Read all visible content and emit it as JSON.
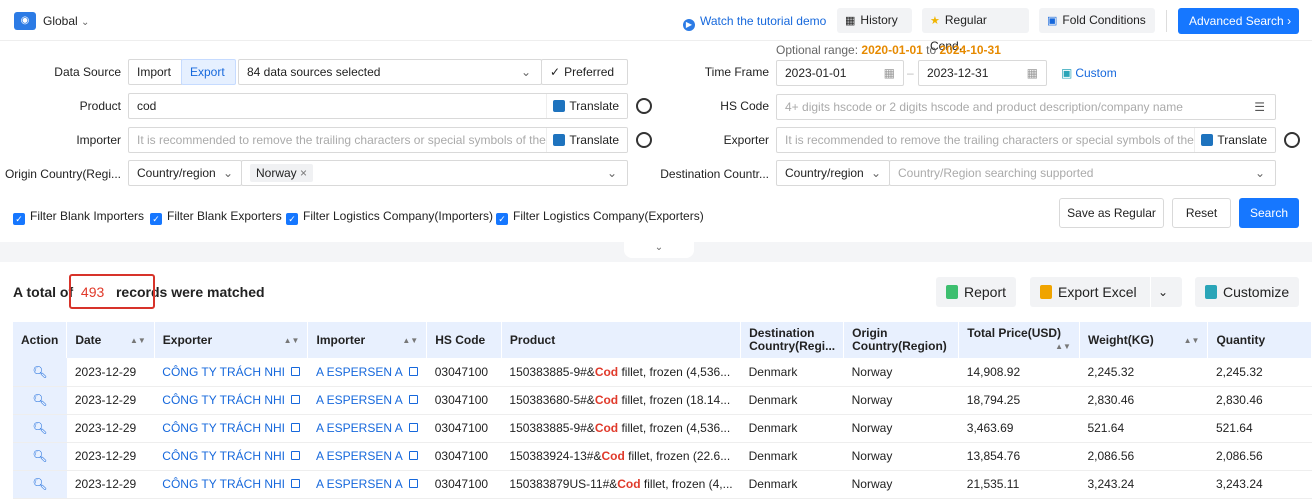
{
  "topbar": {
    "region": "Global",
    "tutorial": "Watch the tutorial demo",
    "history": "History",
    "regular": "Regular Cond.",
    "fold": "Fold Conditions",
    "advanced": "Advanced Search"
  },
  "range": {
    "label": "Optional range:",
    "from": "2020-01-01",
    "to_word": "to",
    "to": "2024-10-31"
  },
  "form": {
    "data_source_label": "Data Source",
    "import": "Import",
    "export": "Export",
    "sources": "84 data sources selected",
    "preferred": "Preferred",
    "time_frame_label": "Time Frame",
    "date_from": "2023-01-01",
    "date_to": "2023-12-31",
    "custom": "Custom",
    "product_label": "Product",
    "product_value": "cod",
    "translate": "Translate",
    "hs_label": "HS Code",
    "hs_placeholder": "4+ digits hscode or 2 digits hscode and product description/company name",
    "importer_label": "Importer",
    "importer_placeholder": "It is recommended to remove the trailing characters or special symbols of the company name",
    "exporter_label": "Exporter",
    "exporter_placeholder": "It is recommended to remove the trailing characters or special symbols of the company name",
    "origin_label": "Origin Country(Regi...",
    "country_region": "Country/region",
    "origin_tag": "Norway",
    "dest_label": "Destination Countr...",
    "dest_placeholder": "Country/Region searching supported"
  },
  "filters": [
    "Filter Blank Importers",
    "Filter Blank Exporters",
    "Filter Logistics Company(Importers)",
    "Filter Logistics Company(Exporters)"
  ],
  "actions": {
    "save": "Save as Regular",
    "reset": "Reset",
    "search": "Search"
  },
  "results": {
    "prefix": "A total of",
    "count": "493",
    "records": "records",
    "suffix": "were matched"
  },
  "tools": {
    "report": "Report",
    "excel": "Export Excel",
    "customize": "Customize"
  },
  "table": {
    "headers": [
      "Action",
      "Date",
      "Exporter",
      "Importer",
      "HS Code",
      "Product",
      "Destination Country(Regi...",
      "Origin Country(Region)",
      "Total Price(USD)",
      "Weight(KG)",
      "Quantity"
    ],
    "rows": [
      {
        "date": "2023-12-29",
        "exporter": "CÔNG TY TRÁCH NHI",
        "importer": "A ESPERSEN A",
        "hs": "03047100",
        "pre": "150383885-9#&",
        "kw": "Cod",
        "post": " fillet, frozen (4,536...",
        "dest": "Denmark",
        "origin": "Norway",
        "price": "14,908.92",
        "weight": "2,245.32",
        "qty": "2,245.32"
      },
      {
        "date": "2023-12-29",
        "exporter": "CÔNG TY TRÁCH NHI",
        "importer": "A ESPERSEN A",
        "hs": "03047100",
        "pre": "150383680-5#&",
        "kw": "Cod",
        "post": " fillet, frozen (18.14...",
        "dest": "Denmark",
        "origin": "Norway",
        "price": "18,794.25",
        "weight": "2,830.46",
        "qty": "2,830.46"
      },
      {
        "date": "2023-12-29",
        "exporter": "CÔNG TY TRÁCH NHI",
        "importer": "A ESPERSEN A",
        "hs": "03047100",
        "pre": "150383885-9#&",
        "kw": "Cod",
        "post": " fillet, frozen (4,536...",
        "dest": "Denmark",
        "origin": "Norway",
        "price": "3,463.69",
        "weight": "521.64",
        "qty": "521.64"
      },
      {
        "date": "2023-12-29",
        "exporter": "CÔNG TY TRÁCH NHI",
        "importer": "A ESPERSEN A",
        "hs": "03047100",
        "pre": "150383924-13#&",
        "kw": "Cod",
        "post": " fillet, frozen (22.6...",
        "dest": "Denmark",
        "origin": "Norway",
        "price": "13,854.76",
        "weight": "2,086.56",
        "qty": "2,086.56"
      },
      {
        "date": "2023-12-29",
        "exporter": "CÔNG TY TRÁCH NHI",
        "importer": "A ESPERSEN A",
        "hs": "03047100",
        "pre": "150383879US-11#&",
        "kw": "Cod",
        "post": " fillet, frozen (4,...",
        "dest": "Denmark",
        "origin": "Norway",
        "price": "21,535.11",
        "weight": "3,243.24",
        "qty": "3,243.24"
      }
    ]
  }
}
